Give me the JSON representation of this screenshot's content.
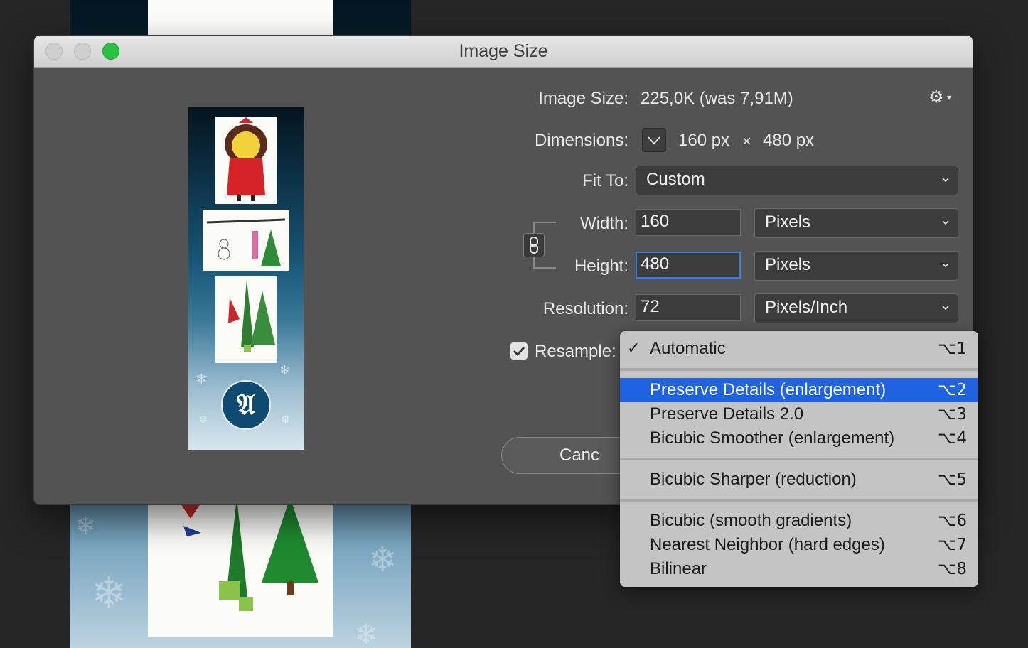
{
  "dialog": {
    "title": "Image Size"
  },
  "form": {
    "image_size_label": "Image Size:",
    "image_size_value": "225,0K (was 7,91M)",
    "dimensions_label": "Dimensions:",
    "dimensions_width": "160 px",
    "dimensions_x": "×",
    "dimensions_height": "480 px",
    "fit_to_label": "Fit To:",
    "fit_to_value": "Custom",
    "width_label": "Width:",
    "width_value": "160",
    "width_unit": "Pixels",
    "height_label": "Height:",
    "height_value": "480",
    "height_unit": "Pixels",
    "resolution_label": "Resolution:",
    "resolution_value": "72",
    "resolution_unit": "Pixels/Inch",
    "resample_label": "Resample:",
    "resample_checked": true
  },
  "buttons": {
    "cancel": "Canc"
  },
  "preview": {
    "logo_glyph": "𝔄"
  },
  "resample_menu": {
    "items": [
      {
        "label": "Automatic",
        "shortcut": "⌥1",
        "checked": true,
        "highlighted": false
      },
      {
        "label": "Preserve Details (enlargement)",
        "shortcut": "⌥2",
        "checked": false,
        "highlighted": true
      },
      {
        "label": "Preserve Details 2.0",
        "shortcut": "⌥3",
        "checked": false,
        "highlighted": false
      },
      {
        "label": "Bicubic Smoother (enlargement)",
        "shortcut": "⌥4",
        "checked": false,
        "highlighted": false
      },
      {
        "label": "Bicubic Sharper (reduction)",
        "shortcut": "⌥5",
        "checked": false,
        "highlighted": false
      },
      {
        "label": "Bicubic (smooth gradients)",
        "shortcut": "⌥6",
        "checked": false,
        "highlighted": false
      },
      {
        "label": "Nearest Neighbor (hard edges)",
        "shortcut": "⌥7",
        "checked": false,
        "highlighted": false
      },
      {
        "label": "Bilinear",
        "shortcut": "⌥8",
        "checked": false,
        "highlighted": false
      }
    ],
    "check_glyph": "✓"
  },
  "colors": {
    "accent": "#1f63e2",
    "focus_ring": "#3b7ce0",
    "dialog_bg": "#535353",
    "zoom_button": "#29c141"
  },
  "icons": {
    "gear": "gear-icon",
    "link": "link-icon",
    "dimension_toggle": "chevron-down-icon"
  }
}
